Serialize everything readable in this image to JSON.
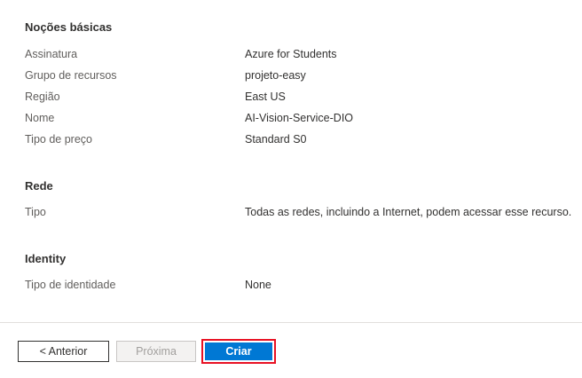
{
  "basics": {
    "title": "Noções básicas",
    "rows": [
      {
        "label": "Assinatura",
        "value": "Azure for Students"
      },
      {
        "label": "Grupo de recursos",
        "value": "projeto-easy"
      },
      {
        "label": "Região",
        "value": "East US"
      },
      {
        "label": "Nome",
        "value": "AI-Vision-Service-DIO"
      },
      {
        "label": "Tipo de preço",
        "value": "Standard S0"
      }
    ]
  },
  "network": {
    "title": "Rede",
    "rows": [
      {
        "label": "Tipo",
        "value": "Todas as redes, incluindo a Internet, podem acessar esse recurso."
      }
    ]
  },
  "identity": {
    "title": "Identity",
    "rows": [
      {
        "label": "Tipo de identidade",
        "value": "None"
      }
    ]
  },
  "footer": {
    "previous_label": "< Anterior",
    "next_label": "Próxima",
    "create_label": "Criar"
  },
  "colors": {
    "primary": "#0078d4",
    "highlight": "#e81123",
    "disabled_text": "#a19f9d"
  }
}
